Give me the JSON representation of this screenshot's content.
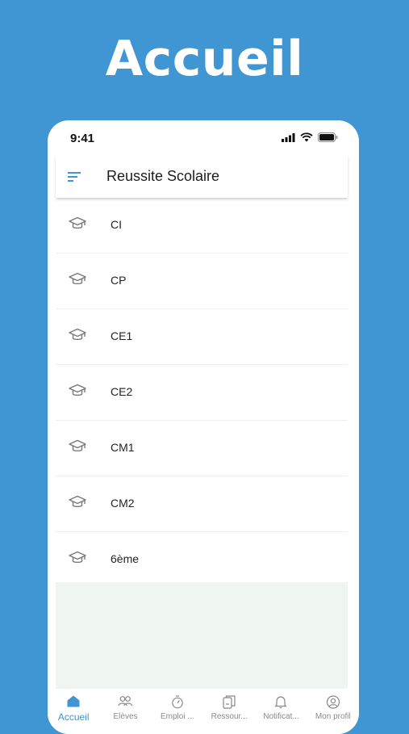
{
  "hero": {
    "title": "Accueil"
  },
  "status_bar": {
    "time": "9:41"
  },
  "app_bar": {
    "title": "Reussite Scolaire"
  },
  "levels": [
    {
      "label": "CI"
    },
    {
      "label": "CP"
    },
    {
      "label": "CE1"
    },
    {
      "label": "CE2"
    },
    {
      "label": "CM1"
    },
    {
      "label": "CM2"
    },
    {
      "label": "6ème"
    }
  ],
  "bottom_nav": {
    "accueil": "Accueil",
    "eleves": "Elèves",
    "emploi": "Emploi ...",
    "ressources": "Ressour...",
    "notifications": "Notificat...",
    "profil": "Mon profil"
  },
  "colors": {
    "accent": "#3f96d3",
    "background": "#3f96d3",
    "empty_area": "#eff6f2"
  }
}
